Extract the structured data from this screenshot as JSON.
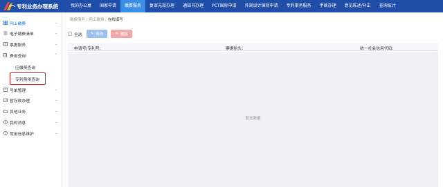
{
  "app": {
    "title": "专利业务办理系统"
  },
  "nav": [
    {
      "label": "我的办公桌"
    },
    {
      "label": "国家申请"
    },
    {
      "label": "缴费服务"
    },
    {
      "label": "复审无效办理"
    },
    {
      "label": "通知书办理"
    },
    {
      "label": "PCT国际申请"
    },
    {
      "label": "外观设计国际申请"
    },
    {
      "label": "专利事务服务"
    },
    {
      "label": "手续办理"
    },
    {
      "label": "意见陈述/补正"
    },
    {
      "label": "查询统计"
    }
  ],
  "nav_active_index": 2,
  "sidebar": {
    "items": [
      {
        "label": "网上缴费",
        "icon": "grid-icon"
      },
      {
        "label": "电子缴费清单",
        "icon": "list-icon"
      },
      {
        "label": "票据服务",
        "icon": "ticket-icon"
      },
      {
        "label": "费用查询",
        "icon": "search-doc-icon"
      },
      {
        "label": "号单管理",
        "icon": "document-icon"
      },
      {
        "label": "暂存款办理",
        "icon": "wallet-icon"
      },
      {
        "label": "其他业务",
        "icon": "folder-icon"
      },
      {
        "label": "我的消息",
        "icon": "bell-icon"
      },
      {
        "label": "常用信息维护",
        "icon": "info-icon"
      }
    ],
    "subitems": [
      {
        "label": "应缴费查询"
      },
      {
        "label": "专利费用查询"
      }
    ]
  },
  "breadcrumb": {
    "level1": "缴费服务",
    "sep": "/",
    "level2": "网上缴费",
    "current": "在线填写"
  },
  "toolbar": {
    "select_all": "全选",
    "edit": "修改",
    "delete": "删除"
  },
  "table": {
    "columns": [
      "申请号/专利号:",
      "票据抬头:",
      "统一社会信用代码:"
    ],
    "empty_text": "暂无数据"
  },
  "colors": {
    "topbar": "#1f4ea8",
    "nav_active": "#3a8ee6",
    "highlight_box": "#e02020"
  }
}
